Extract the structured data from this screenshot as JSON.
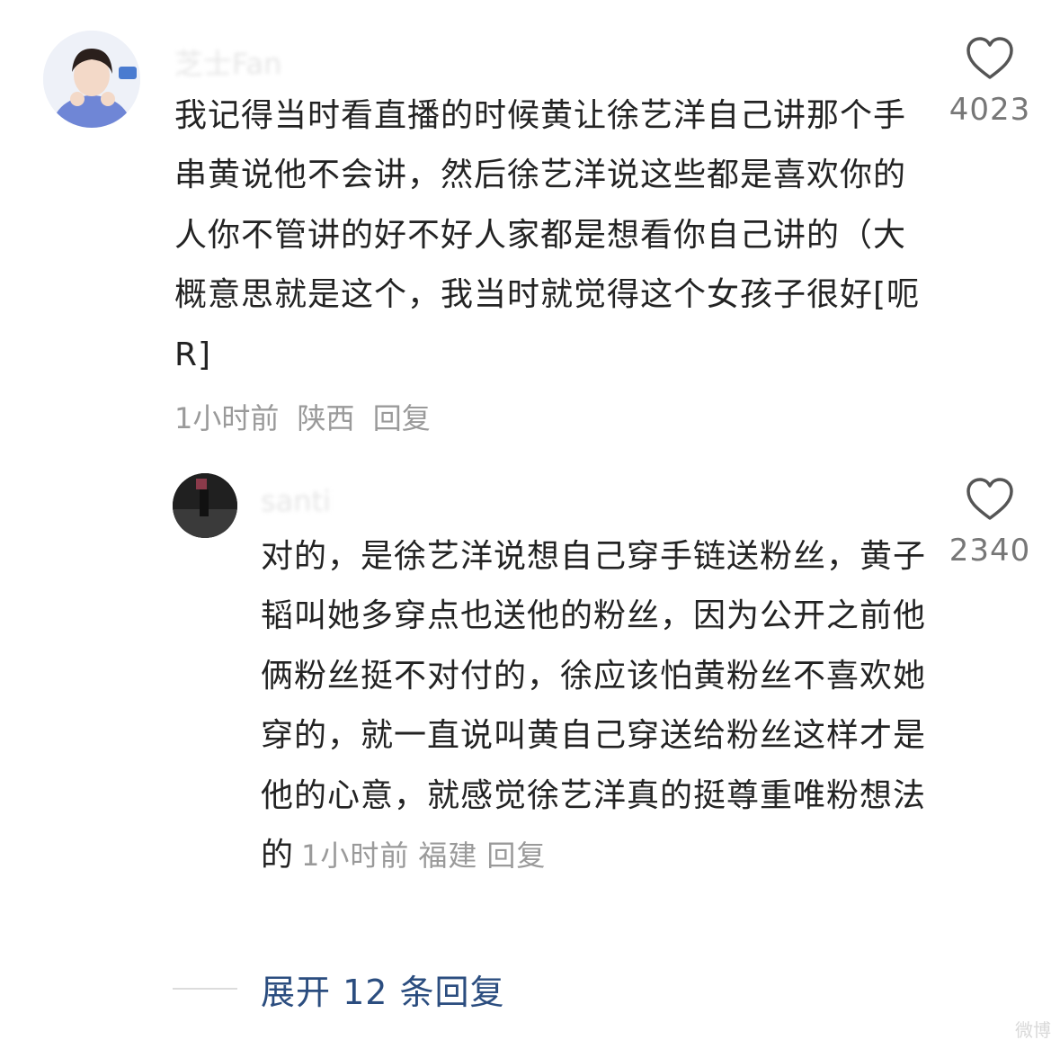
{
  "comment": {
    "username": "芝士Fan",
    "text": "我记得当时看直播的时候黄让徐艺洋自己讲那个手串黄说他不会讲，然后徐艺洋说这些都是喜欢你的人你不管讲的好不好人家都是想看你自己讲的（大概意思就是这个，我当时就觉得这个女孩子很好[呃R]",
    "time": "1小时前",
    "location": "陕西",
    "reply_label": "回复",
    "likes": "4023"
  },
  "reply": {
    "username": "santi",
    "text": "对的，是徐艺洋说想自己穿手链送粉丝，黄子韬叫她多穿点也送他的粉丝，因为公开之前他俩粉丝挺不对付的，徐应该怕黄粉丝不喜欢她穿的，就一直说叫黄自己穿送给粉丝这样才是他的心意，就感觉徐艺洋真的挺尊重唯粉想法的",
    "time": "1小时前",
    "location": "福建",
    "reply_label": "回复",
    "likes": "2340"
  },
  "expand": {
    "label": "展开 12 条回复"
  },
  "watermark": "微博"
}
